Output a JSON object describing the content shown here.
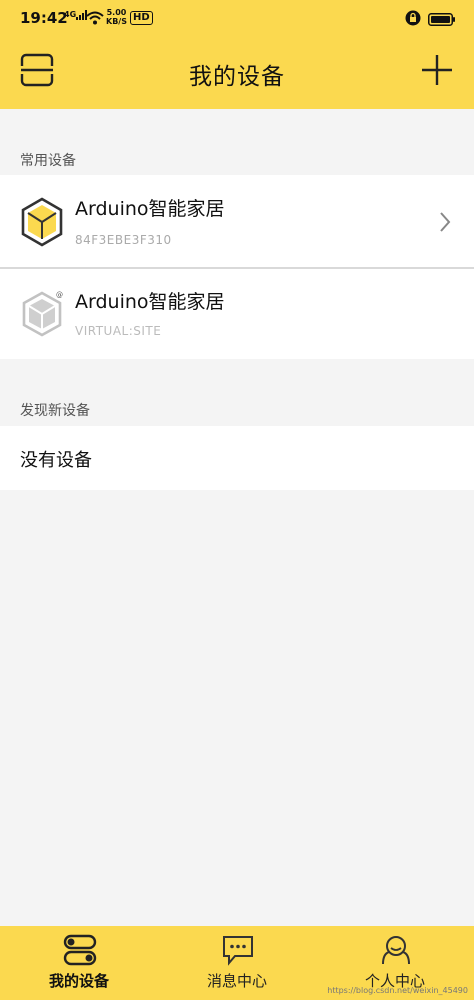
{
  "status": {
    "time": "19:42",
    "signal": "4G",
    "speed_top": "5.00",
    "speed_bottom": "KB/S",
    "hd": "HD"
  },
  "header": {
    "title": "我的设备",
    "left_icon": "scan-icon",
    "right_icon": "plus-icon"
  },
  "frequent": {
    "label": "常用设备",
    "devices": [
      {
        "name": "Arduino智能家居",
        "id": "84F3EBE3F310",
        "icon": "cube-icon",
        "color": "#fbd94f"
      },
      {
        "name": "Arduino智能家居",
        "id": "VIRTUAL:SITE",
        "icon": "cube-icon",
        "color": "#c8c8c8"
      }
    ]
  },
  "discover": {
    "label": "发现新设备",
    "empty_text": "没有设备"
  },
  "nav": {
    "tabs": [
      {
        "label": "我的设备",
        "icon": "devices-icon"
      },
      {
        "label": "消息中心",
        "icon": "message-icon"
      },
      {
        "label": "个人中心",
        "icon": "profile-icon"
      }
    ]
  },
  "watermark": "https://blog.csdn.net/weixin_45490"
}
